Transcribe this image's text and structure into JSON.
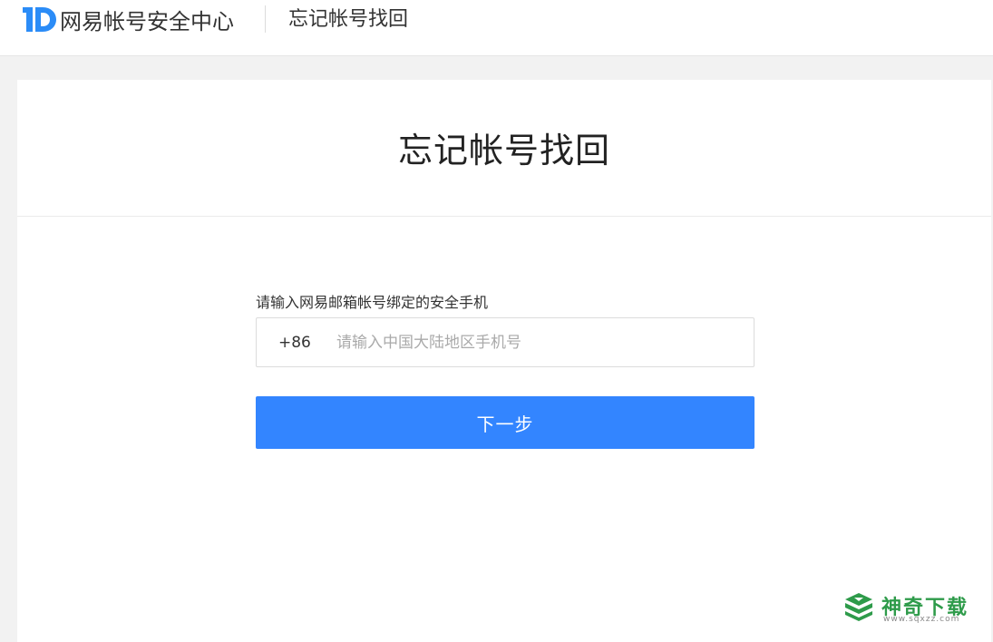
{
  "header": {
    "site_title": "网易帐号安全中心",
    "sub_title": "忘记帐号找回"
  },
  "main": {
    "page_title": "忘记帐号找回",
    "field_label": "请输入网易邮箱帐号绑定的安全手机",
    "country_code": "+86",
    "phone_placeholder": "请输入中国大陆地区手机号",
    "phone_value": "",
    "next_button_label": "下一步"
  },
  "watermark": {
    "name": "神奇下载",
    "url": "www.sqxzz.com"
  },
  "colors": {
    "accent": "#3385ff",
    "logo": "#2b8cf7",
    "watermark": "#2e9b4a"
  },
  "icons": {
    "logo": "netease-id-logo-icon",
    "watermark": "shenqi-logo-icon"
  }
}
